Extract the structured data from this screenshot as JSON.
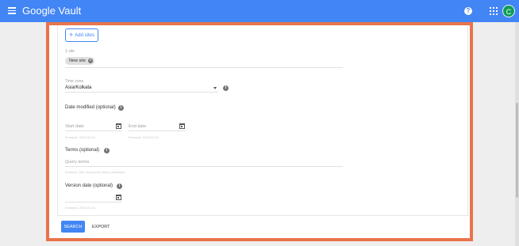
{
  "header": {
    "app_title": "Google Vault",
    "help_glyph": "?",
    "avatar_initial": "C"
  },
  "sites": {
    "add_label": "Add sites",
    "count_label": "1 site",
    "chip_label": "New site",
    "chip_remove_glyph": "×"
  },
  "timezone": {
    "label": "Time zone",
    "value": "Asia/Kolkata"
  },
  "date_modified": {
    "label": "Date modified (optional)",
    "start_placeholder": "Start date",
    "end_placeholder": "End date",
    "start_example": "Example: 2019-03-01",
    "end_example": "Example: 2019-03-31"
  },
  "terms": {
    "label": "Terms (optional)",
    "placeholder": "Query terms",
    "example": "Example: (tax document) minus (estimate)"
  },
  "version_date": {
    "label": "Version date (optional)",
    "example": "Example: 2019-03-31"
  },
  "actions": {
    "search_label": "SEARCH",
    "export_label": "EXPORT"
  },
  "icons": {
    "info_glyph": "i"
  },
  "colors": {
    "header_blue": "#4285f4",
    "frame_orange": "#e8744b",
    "avatar_green": "#0f9d58"
  }
}
